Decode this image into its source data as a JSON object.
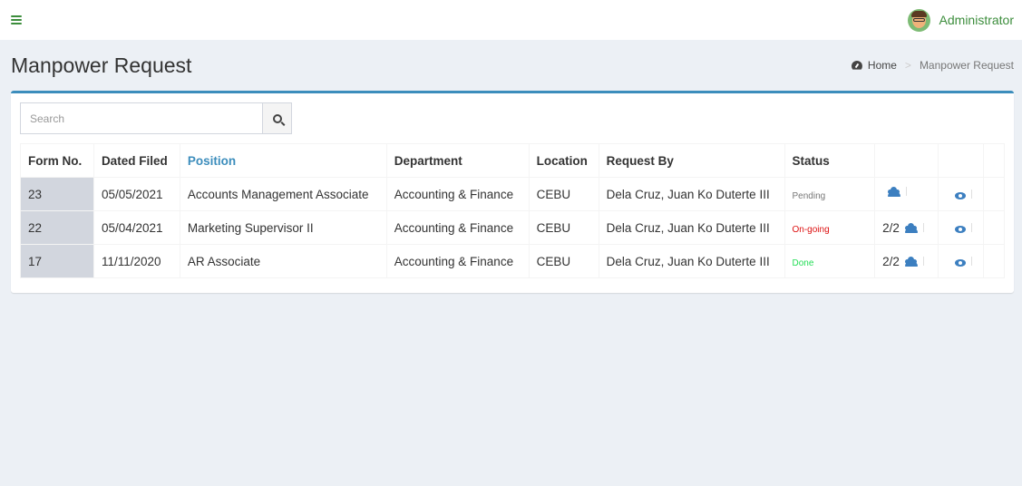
{
  "header": {
    "username": "Administrator"
  },
  "page": {
    "title": "Manpower Request",
    "breadcrumb_home": "Home",
    "breadcrumb_current": "Manpower Request"
  },
  "search": {
    "placeholder": "Search"
  },
  "table": {
    "columns": [
      "Form No.",
      "Dated Filed",
      "Position",
      "Department",
      "Location",
      "Request By",
      "Status"
    ],
    "rows": [
      {
        "form_no": "23",
        "date": "05/05/2021",
        "position": "Accounts Management Associate",
        "department": "Accounting & Finance",
        "location": "CEBU",
        "request_by": "Dela Cruz, Juan Ko Duterte III",
        "status": "Pending",
        "count": ""
      },
      {
        "form_no": "22",
        "date": "05/04/2021",
        "position": "Marketing Supervisor II",
        "department": "Accounting & Finance",
        "location": "CEBU",
        "request_by": "Dela Cruz, Juan Ko Duterte III",
        "status": "On-going",
        "count": "2/2"
      },
      {
        "form_no": "17",
        "date": "11/11/2020",
        "position": "AR Associate",
        "department": "Accounting & Finance",
        "location": "CEBU",
        "request_by": "Dela Cruz, Juan Ko Duterte III",
        "status": "Done",
        "count": "2/2"
      }
    ]
  },
  "icons": {
    "menu": "hamburger-menu-icon",
    "dashboard": "dashboard-icon",
    "search": "search-icon",
    "applicants": "users-icon",
    "view": "eye-icon"
  },
  "colors": {
    "accent": "#3c8dbc",
    "brand_green": "#3c8d3c",
    "status_pending": "#777777",
    "status_ongoing": "#dd1111",
    "status_done": "#22dd55"
  }
}
